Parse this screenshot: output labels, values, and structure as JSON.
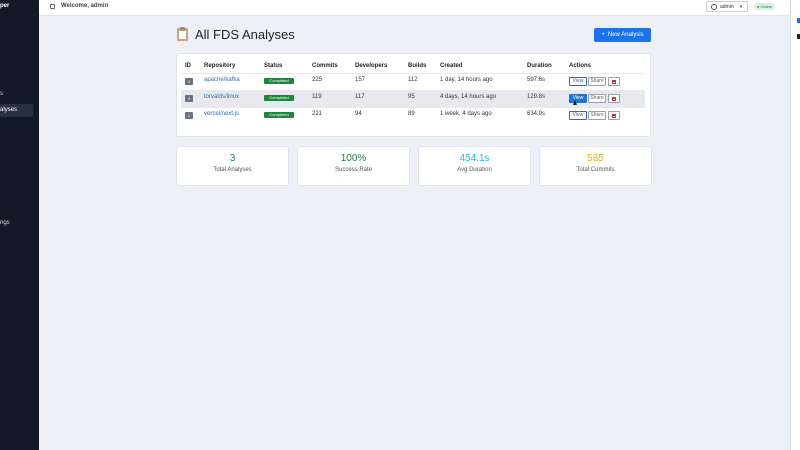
{
  "sidebar": {
    "brand": "per",
    "items": [
      {
        "label": "s"
      },
      {
        "label": "alyses"
      },
      {
        "label": "ngs"
      }
    ]
  },
  "topbar": {
    "welcome": "Welcome, admin",
    "user": "admin",
    "status": "Online"
  },
  "page": {
    "title": "All FDS Analyses",
    "new_button": "New Analysis"
  },
  "table": {
    "headers": [
      "ID",
      "Repository",
      "Status",
      "Commits",
      "Developers",
      "Builds",
      "Created",
      "Duration",
      "Actions"
    ],
    "rows": [
      {
        "id": "2",
        "repository": "apache/kafka",
        "status": "Completed",
        "commits": "225",
        "developers": "157",
        "builds": "112",
        "created": "1 day, 14 hours ago",
        "duration": "597.6s"
      },
      {
        "id": "3",
        "repository": "torvalds/linux",
        "status": "Completed",
        "commits": "119",
        "developers": "117",
        "builds": "95",
        "created": "4 days, 14 hours ago",
        "duration": "129.8s"
      },
      {
        "id": "1",
        "repository": "vercel/next.js",
        "status": "Completed",
        "commits": "221",
        "developers": "94",
        "builds": "89",
        "created": "1 week, 4 days ago",
        "duration": "634.9s"
      }
    ],
    "actions": {
      "view": "View",
      "share": "Share"
    }
  },
  "stats": [
    {
      "value": "3",
      "label": "Total Analyses",
      "color": "#1f7fa8"
    },
    {
      "value": "100%",
      "label": "Success Rate",
      "color": "#20843e"
    },
    {
      "value": "454.1s",
      "label": "Avg Duration",
      "color": "#22b8cf"
    },
    {
      "value": "585",
      "label": "Total Commits",
      "color": "#e0b31b"
    }
  ]
}
